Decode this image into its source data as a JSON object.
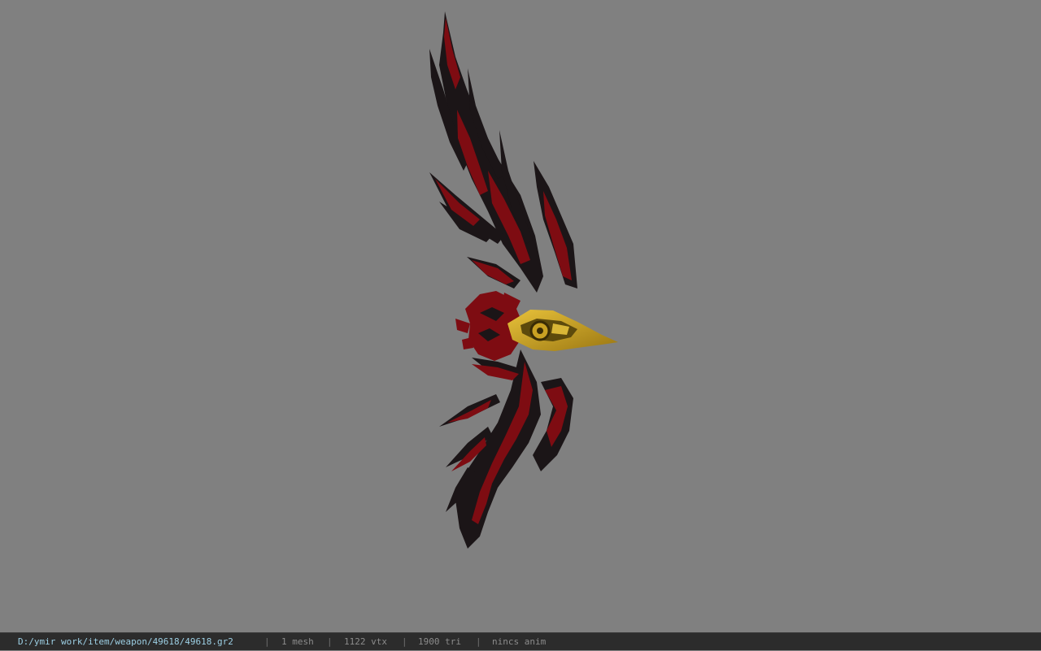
{
  "viewport": {
    "background": "#808080",
    "model": {
      "description": "weapon model",
      "colors": {
        "dark": "#1b1517",
        "red": "#7e0c12",
        "gold": "#caa122",
        "gold_dark": "#5d4a0c"
      }
    }
  },
  "status_bar": {
    "file_path": "D:/ymir work/item/weapon/49618/49618.gr2",
    "separator": "|",
    "mesh": "1 mesh",
    "vertices": "1122 vtx",
    "triangles": "1900 tri",
    "animation": "nincs anim"
  }
}
